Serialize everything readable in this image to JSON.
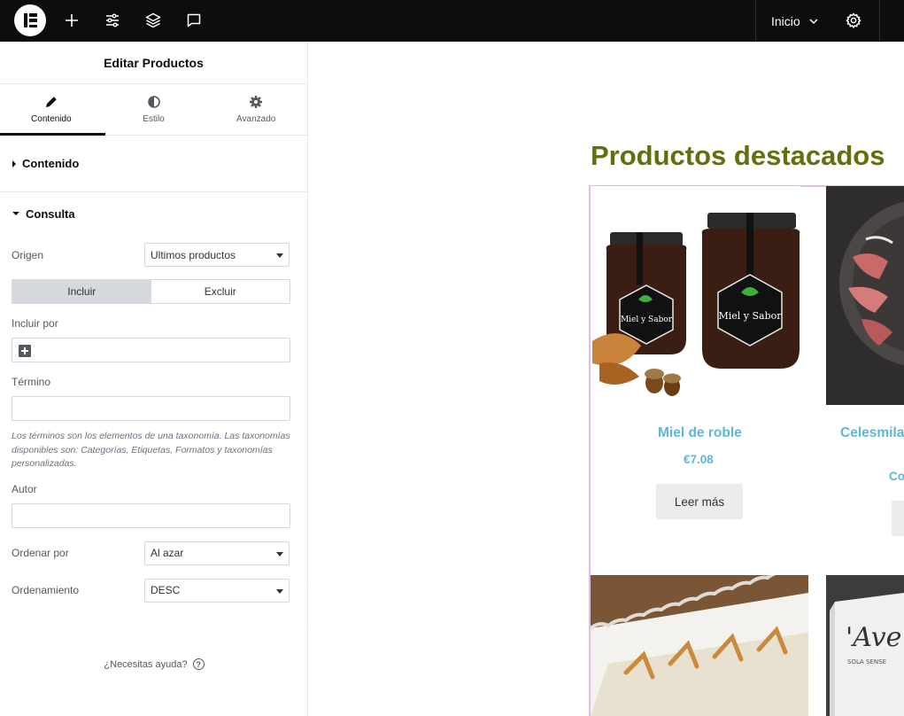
{
  "topbar": {
    "page_name": "Inicio",
    "icons": [
      "elementor-logo-icon",
      "plus-icon",
      "settings-sliders-icon",
      "layers-icon",
      "comment-icon",
      "chevron-down-icon",
      "gear-icon"
    ]
  },
  "panel": {
    "title": "Editar Productos",
    "tabs": [
      {
        "label": "Contenido",
        "icon": "pencil-icon",
        "active": true
      },
      {
        "label": "Estilo",
        "icon": "half-circle-icon",
        "active": false
      },
      {
        "label": "Avanzado",
        "icon": "gear-icon",
        "active": false
      }
    ],
    "section_contenido": "Contenido",
    "section_consulta": "Consulta",
    "origen_label": "Origen",
    "origen_value": "Ultimos productos",
    "switch_incluir": "Incluir",
    "switch_excluir": "Excluir",
    "incluir_por_label": "Incluir por",
    "termino_label": "Término",
    "help_text": "Los términos son los elementos de una taxonomía. Las taxonomías disponibles son: Categorías, Etiquetas, Formatos y taxonomías personalizadas.",
    "autor_label": "Autor",
    "ordenar_por_label": "Ordenar por",
    "ordenar_por_value": "Al azar",
    "ordenamiento_label": "Ordenamiento",
    "ordenamiento_value": "DESC",
    "help_link": "¿Necesitas ayuda?"
  },
  "preview": {
    "heading": "Productos destacados",
    "products": [
      {
        "name": "Miel de roble",
        "price": "€7.08",
        "button": "Leer más"
      },
      {
        "name": "Celesmila",
        "price": "Co",
        "button": ""
      }
    ]
  },
  "colors": {
    "topbar_bg": "#0c0d0e",
    "heading": "#61700d",
    "product_link": "#5fb7d6",
    "widget_outline": "#e5b9e5"
  }
}
